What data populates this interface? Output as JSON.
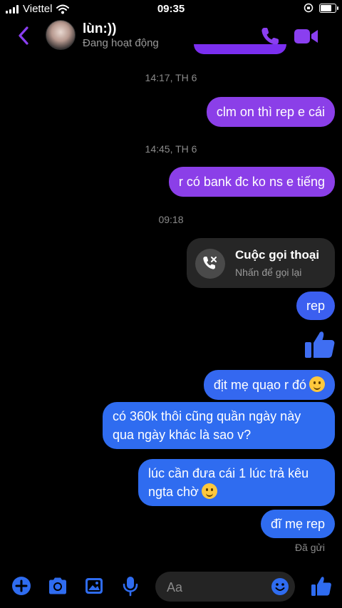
{
  "status_bar": {
    "carrier": "Viettel",
    "time": "09:35"
  },
  "header": {
    "contact_name": "lùn:))",
    "contact_status": "Đang hoạt động"
  },
  "messages": [
    {
      "type": "timestamp",
      "text": "14:17, TH 6"
    },
    {
      "type": "sent",
      "text": "clm on thì rep e cái",
      "color": "#8b3fe8"
    },
    {
      "type": "timestamp",
      "text": "14:45, TH 6"
    },
    {
      "type": "sent",
      "text": "r có bank đc ko ns e tiếng",
      "color": "#8b3fe8"
    },
    {
      "type": "timestamp",
      "text": "09:18"
    },
    {
      "type": "call",
      "title": "Cuộc gọi thoại",
      "subtitle": "Nhấn để gọi lại"
    },
    {
      "type": "sent",
      "text": "rep",
      "color": "#3b5ff0"
    },
    {
      "type": "like"
    },
    {
      "type": "sent",
      "text": "địt mẹ quạo r đó",
      "emoji": "slightly-smiling-face",
      "color": "#3468f0"
    },
    {
      "type": "sent",
      "text": "có 360k thôi cũng quần ngày này qua ngày khác là sao v?",
      "color": "#2f6cf0"
    },
    {
      "type": "sent",
      "text": "lúc cần đưa cái 1 lúc trả kêu ngta chờ",
      "emoji": "slightly-smiling-face",
      "color": "#2f6cf0"
    },
    {
      "type": "sent",
      "text": "đĩ mẹ rep",
      "color": "#2f6cf0"
    }
  ],
  "seen_status": "Đã gửi",
  "composer": {
    "placeholder": "Aa"
  },
  "colors": {
    "accent": "#8a3ff0",
    "blue": "#2f6cf0",
    "background": "#000000"
  }
}
